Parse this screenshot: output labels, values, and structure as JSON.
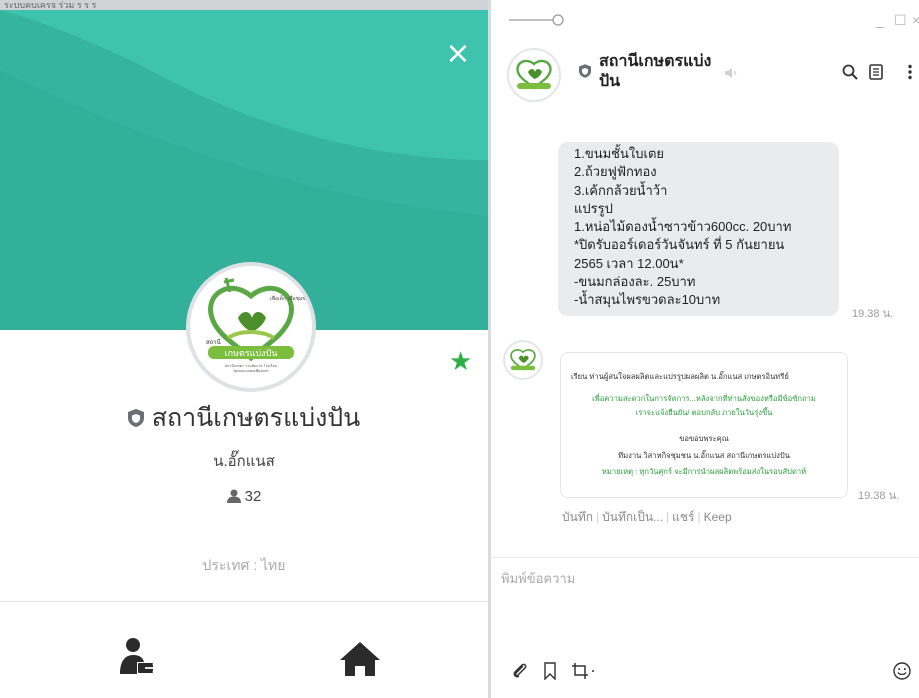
{
  "profile": {
    "top_strip_text": "ระบบคบเครจ   ร่วม   ร   ร   ร",
    "close_glyph": "×",
    "logo": {
      "line1": "สถานี",
      "line2": "เกษตรแบ่งปัน",
      "small_text": "เพื่อเด็ก เพื่อชุมชน",
      "tiny1": "สถานีเกษตร ร.เฉลิมแก่ง โรงเรียน",
      "tiny2": "ชุมชนแบบพอเพียงแพร่"
    },
    "name": "สถานีเกษตรแบ่งปัน",
    "subtitle": "น.อั๊กแนส",
    "friends_count": "32",
    "country": "ประเทศ : ไทย",
    "buttons": [
      "share-account",
      "home"
    ],
    "colors": {
      "teal": "#36b49f",
      "teal_light": "#3ec4ae",
      "star": "#2eaf47"
    }
  },
  "chat": {
    "header": {
      "name": "สถานีเกษตรแบ่งปัน"
    },
    "message1": {
      "lines": [
        "1.ขนมชั้นใบเตย",
        "2.ถ้วยฟูฟักทอง",
        "3.เค้กกล้วยน้ำว้า",
        "แปรรูป",
        "1.หน่อไม้ดองน้ำซาวข้าว600cc. 20บาท",
        "*ปิดรับออร์เดอร์วันจันทร์ ที่ 5 กันยายน",
        "2565 เวลา 12.00น*",
        "-ขนมกล่องละ.       25บาท",
        "-น้ำสมุนไพรขวดละ10บาท"
      ],
      "time": "19.38 น."
    },
    "message2": {
      "card_lines": [
        "เรียน  ท่านผู้สนใจผลผลิตและแปรรูปผลผลิต น.อั๊กแนส เกษตรอินทรีย์",
        "เพื่อความสะดวกในการจัดการ...หลังจากที่ท่านสั่งของหรือมีข้อซักถาม",
        "เราจะแจ้งยืนยัน/ ตอบกลับ ภายในวันรุ่งขึ้น",
        "ขอขอบพระคุณ",
        "ทีมงาน วิสาหกิจชุมชน น.อั๊กแนส สถานีเกษตรแบ่งปัน",
        "หมายเหตุ : ทุกวันศุกร์ จะมีการนำผลผลิตพร้อมส่งในรอบสัปดาห์"
      ],
      "time": "19.38 น."
    },
    "actions": [
      "บันทึก",
      "บันทึกเป็น...",
      "แชร์",
      "Keep"
    ],
    "composer_placeholder": "พิมพ์ข้อความ"
  }
}
